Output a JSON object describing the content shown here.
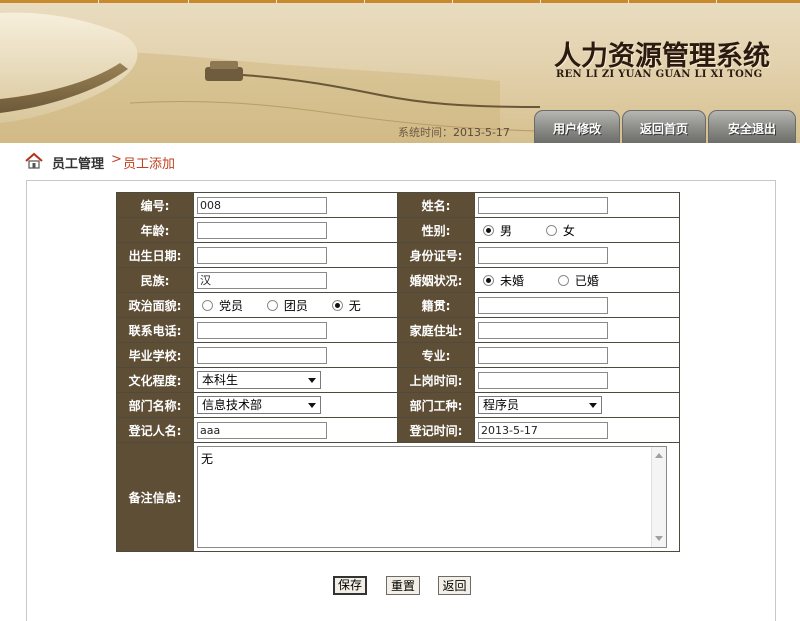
{
  "header": {
    "title_cn": "人力资源管理系统",
    "title_en": "REN LI ZI YUAN GUAN LI XI TONG",
    "systime_label": "系统时间：",
    "systime_value": "2013-5-17",
    "nav": {
      "user_modify": "用户修改",
      "home": "返回首页",
      "logout": "安全退出"
    }
  },
  "breadcrumb": {
    "section": "员工管理",
    "separator": ">",
    "current": "员工添加"
  },
  "form": {
    "labels": {
      "id": "编号:",
      "name": "姓名:",
      "age": "年龄:",
      "gender": "性别:",
      "birthday": "出生日期:",
      "id_card": "身份证号:",
      "nation": "民族:",
      "marital": "婚姻状况:",
      "political": "政治面貌:",
      "native_place": "籍贯:",
      "phone": "联系电话:",
      "address": "家庭住址:",
      "school": "毕业学校:",
      "major": "专业:",
      "education": "文化程度:",
      "start_date": "上岗时间:",
      "department": "部门名称:",
      "job_type": "部门工种:",
      "registrar": "登记人名:",
      "register_time": "登记时间:",
      "remark": "备注信息:"
    },
    "values": {
      "id": "008",
      "name": "",
      "age": "",
      "birthday": "",
      "id_card": "",
      "nation": "汉",
      "native_place": "",
      "phone": "",
      "address": "",
      "school": "",
      "major": "",
      "start_date": "",
      "registrar": "aaa",
      "register_time": "2013-5-17",
      "remark": "无"
    },
    "gender_options": [
      "男",
      "女"
    ],
    "gender_selected": "男",
    "marital_options": [
      "未婚",
      "已婚"
    ],
    "marital_selected": "未婚",
    "political_options": [
      "党员",
      "团员",
      "无"
    ],
    "political_selected": "无",
    "education_selected": "本科生",
    "department_selected": "信息技术部",
    "job_type_selected": "程序员"
  },
  "actions": {
    "save": "保存",
    "reset": "重置",
    "back": "返回"
  },
  "colors": {
    "label_bg": "#5e4e36",
    "accent_red": "#c2411f",
    "header_bg": "#e3d2ae"
  }
}
